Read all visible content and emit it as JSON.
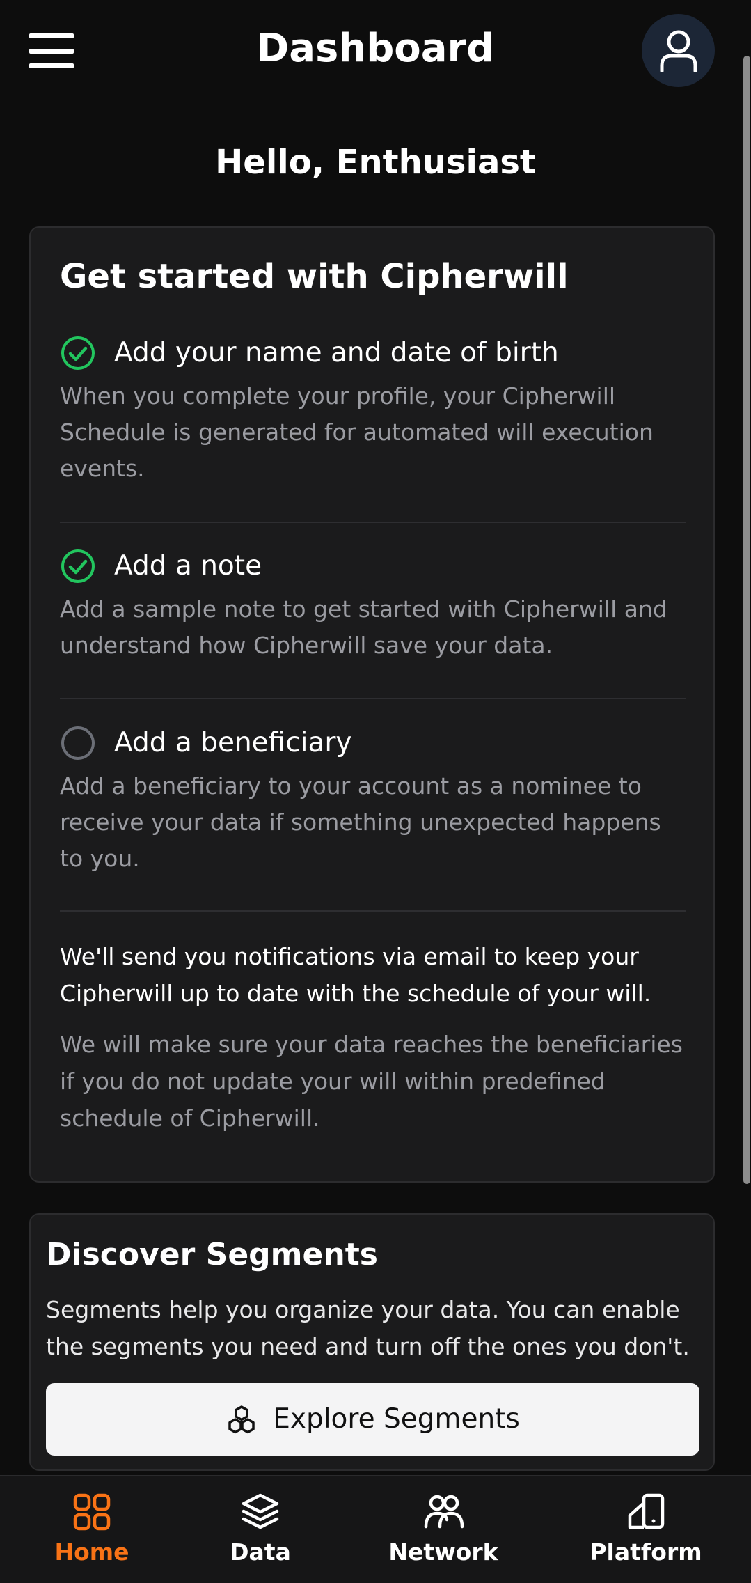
{
  "header": {
    "title": "Dashboard"
  },
  "greeting": "Hello, Enthusiast",
  "getting_started": {
    "title": "Get started with Cipherwill",
    "steps": [
      {
        "title": "Add your name and date of birth",
        "description": "When you complete your profile, your Cipherwill Schedule is generated for automated will execution events.",
        "completed": true
      },
      {
        "title": "Add a note",
        "description": "Add a sample note to get started with Cipherwill and understand how Cipherwill save your data.",
        "completed": true
      },
      {
        "title": "Add a beneficiary",
        "description": "Add a beneficiary to your account as a nominee to receive your data if something unexpected happens to you.",
        "completed": false
      }
    ],
    "notice_primary": "We'll send you notifications via email to keep your Cipherwill up to date with the schedule of your will.",
    "notice_secondary": "We will make sure your data reaches the beneficiaries if you do not update your will within predefined schedule of Cipherwill."
  },
  "segments": {
    "title": "Discover Segments",
    "description": "Segments help you organize your data. You can enable the segments you need and turn off the ones you don't.",
    "button_label": "Explore Segments"
  },
  "bottom_nav": [
    {
      "label": "Home",
      "icon": "home-grid-icon",
      "active": true
    },
    {
      "label": "Data",
      "icon": "layers-icon",
      "active": false
    },
    {
      "label": "Network",
      "icon": "users-icon",
      "active": false
    },
    {
      "label": "Platform",
      "icon": "devices-icon",
      "active": false
    }
  ],
  "colors": {
    "accent": "#f97316",
    "success": "#22c55e",
    "background": "#0d0d0d",
    "card": "#1b1b1c"
  }
}
